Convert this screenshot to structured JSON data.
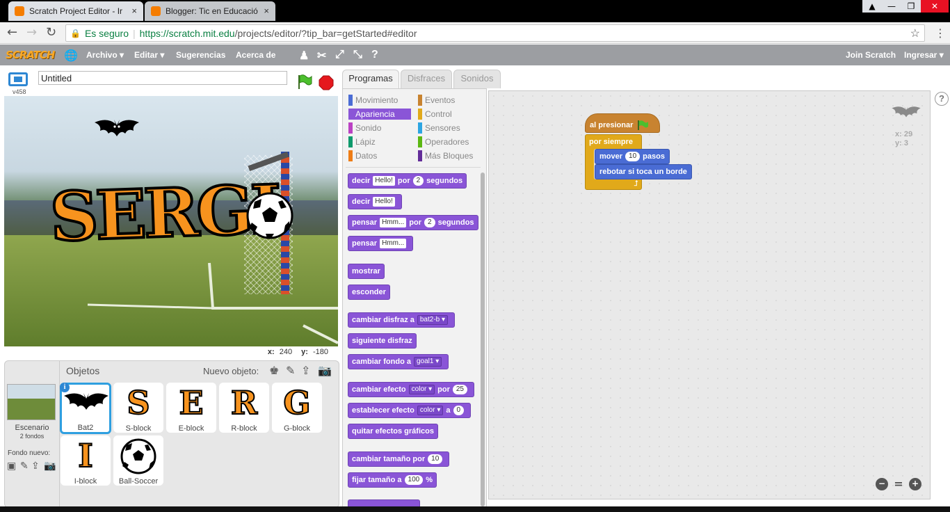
{
  "browser": {
    "tabs": [
      {
        "title": "Scratch Project Editor - Ir",
        "close": "×"
      },
      {
        "title": "Blogger: Tic en Educació",
        "close": "×"
      }
    ],
    "window_controls": [
      "▲",
      "—",
      "❐",
      "✕"
    ],
    "secure_label": "Es seguro",
    "url_host": "https://scratch.mit.edu",
    "url_path": "/projects/editor/?tip_bar=getStarted#editor"
  },
  "menu": {
    "logo": "SCRATCH",
    "items": [
      "Archivo ▾",
      "Editar ▾",
      "Sugerencias",
      "Acerca de"
    ],
    "join": "Join Scratch",
    "login": "Ingresar ▾"
  },
  "stage": {
    "version": "v458",
    "project_title": "Untitled",
    "x_label": "x:",
    "x_value": "240",
    "y_label": "y:",
    "y_value": "-180",
    "big_text": "SERGI"
  },
  "sprites": {
    "header": "Objetos",
    "new_object_label": "Nuevo objeto:",
    "stage_label": "Escenario",
    "stage_backdrops": "2 fondos",
    "new_backdrop_label": "Fondo nuevo:",
    "items": [
      {
        "name": "Bat2",
        "glyph": ""
      },
      {
        "name": "S-block",
        "glyph": "S"
      },
      {
        "name": "E-block",
        "glyph": "E"
      },
      {
        "name": "R-block",
        "glyph": "R"
      },
      {
        "name": "G-block",
        "glyph": "G"
      },
      {
        "name": "I-block",
        "glyph": "I"
      },
      {
        "name": "Ball-Soccer",
        "glyph": ""
      }
    ]
  },
  "palette": {
    "tabs": [
      "Programas",
      "Disfraces",
      "Sonidos"
    ],
    "categories_left": [
      {
        "label": "Movimiento",
        "color": "#4a6cd4"
      },
      {
        "label": "Apariencia",
        "color": "#8a55d7"
      },
      {
        "label": "Sonido",
        "color": "#bb42c3"
      },
      {
        "label": "Lápiz",
        "color": "#0e9a6c"
      },
      {
        "label": "Datos",
        "color": "#ee7d16"
      }
    ],
    "categories_right": [
      {
        "label": "Eventos",
        "color": "#c88330"
      },
      {
        "label": "Control",
        "color": "#e1a91a"
      },
      {
        "label": "Sensores",
        "color": "#2ca5e2"
      },
      {
        "label": "Operadores",
        "color": "#5cb712"
      },
      {
        "label": "Más Bloques",
        "color": "#632d99"
      }
    ],
    "blocks": {
      "b1": {
        "a": "decir",
        "in": "Hello!",
        "b": "por",
        "num": "2",
        "c": "segundos"
      },
      "b2": {
        "a": "decir",
        "in": "Hello!"
      },
      "b3": {
        "a": "pensar",
        "in": "Hmm...",
        "b": "por",
        "num": "2",
        "c": "segundos"
      },
      "b4": {
        "a": "pensar",
        "in": "Hmm..."
      },
      "b5": "mostrar",
      "b6": "esconder",
      "b7": {
        "a": "cambiar disfraz a",
        "dd": "bat2-b ▾"
      },
      "b8": "siguiente disfraz",
      "b9": {
        "a": "cambiar fondo a",
        "dd": "goal1 ▾"
      },
      "b10": {
        "a": "cambiar efecto",
        "dd": "color ▾",
        "b": "por",
        "num": "25"
      },
      "b11": {
        "a": "establecer efecto",
        "dd": "color ▾",
        "b": "a",
        "num": "0"
      },
      "b12": "quitar efectos gráficos",
      "b13": {
        "a": "cambiar tamaño por",
        "num": "10"
      },
      "b14": {
        "a": "fijar tamaño a",
        "num": "100",
        "c": "%"
      }
    }
  },
  "script": {
    "hat": "al presionar",
    "forever": "por siempre",
    "move_a": "mover",
    "move_num": "10",
    "move_b": "pasos",
    "bounce": "rebotar si toca un borde",
    "sprite_x": "x: 29",
    "sprite_y": "y: 3",
    "loop_arrow": "⮥"
  },
  "help": "?"
}
